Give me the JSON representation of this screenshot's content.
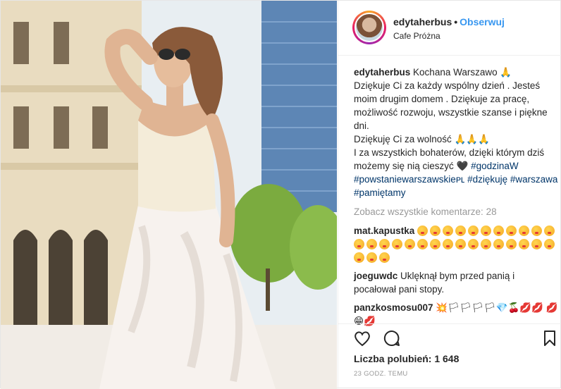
{
  "header": {
    "username": "edytaherbus",
    "separator": "•",
    "follow_label": "Obserwuj",
    "location": "Cafe Próżna"
  },
  "caption": {
    "username": "edytaherbus",
    "lines": [
      "Kochana Warszawo 🙏",
      "Dziękuje Ci za każdy wspólny dzień . Jesteś moim drugim domem . Dziękuje za pracę, możliwość rozwoju, wszystkie szanse i piękne dni.",
      "Dziękuję Ci za wolność 🙏🙏🙏",
      "I za wszystkich bohaterów, dzięki którym dziś możemy się nią cieszyć 🖤"
    ],
    "hashtags": [
      "#godzinaW",
      "#powstaniewarszawskieᴘʟ",
      "#dziękuję",
      "#warszawa",
      "#pamiętamy"
    ]
  },
  "view_all_comments": "Zobacz wszystkie komentarze: 28",
  "comments": [
    {
      "username": "mat.kapustka",
      "text": "",
      "emoji_count": 30
    },
    {
      "username": "joeguwdc",
      "text": "Uklęknął bym przed panią i pocałował pani stopy.",
      "emoji_count": 0
    },
    {
      "username": "panzkosmosu007",
      "text": "💥🏳🏳🏳🏳💎🍒💋💋 💋😁💋",
      "emoji_count": 0
    }
  ],
  "actions": {
    "like_icon": "heart-outline-icon",
    "comment_icon": "comment-bubble-icon",
    "save_icon": "bookmark-icon"
  },
  "likes_label": "Liczba polubień: 1 648",
  "timestamp": "23 GODZ. TEMU",
  "colors": {
    "follow": "#3897f0",
    "hashtag": "#003569",
    "muted": "#999999",
    "border": "#efefef"
  }
}
